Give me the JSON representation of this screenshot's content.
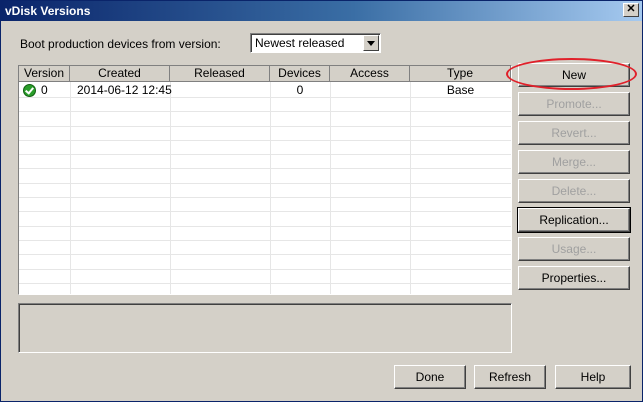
{
  "window": {
    "title": "vDisk Versions",
    "close_glyph": "✕"
  },
  "boot": {
    "label": "Boot production devices from version:",
    "selected": "Newest released"
  },
  "table": {
    "columns": [
      "Version",
      "Created",
      "Released",
      "Devices",
      "Access",
      "Type"
    ],
    "rows": [
      {
        "version": "0",
        "created": "2014-06-12 12:45",
        "released": "",
        "devices": "0",
        "access": "",
        "type": "Base",
        "status_icon": "check-icon"
      }
    ]
  },
  "side_buttons": {
    "new": "New",
    "promote": "Promote...",
    "revert": "Revert...",
    "merge": "Merge...",
    "delete": "Delete...",
    "replication": "Replication...",
    "usage": "Usage...",
    "properties": "Properties..."
  },
  "bottom_buttons": {
    "done": "Done",
    "refresh": "Refresh",
    "help": "Help"
  },
  "colors": {
    "highlight": "#e0202a",
    "title_start": "#0a246a",
    "title_end": "#a6caf0"
  }
}
